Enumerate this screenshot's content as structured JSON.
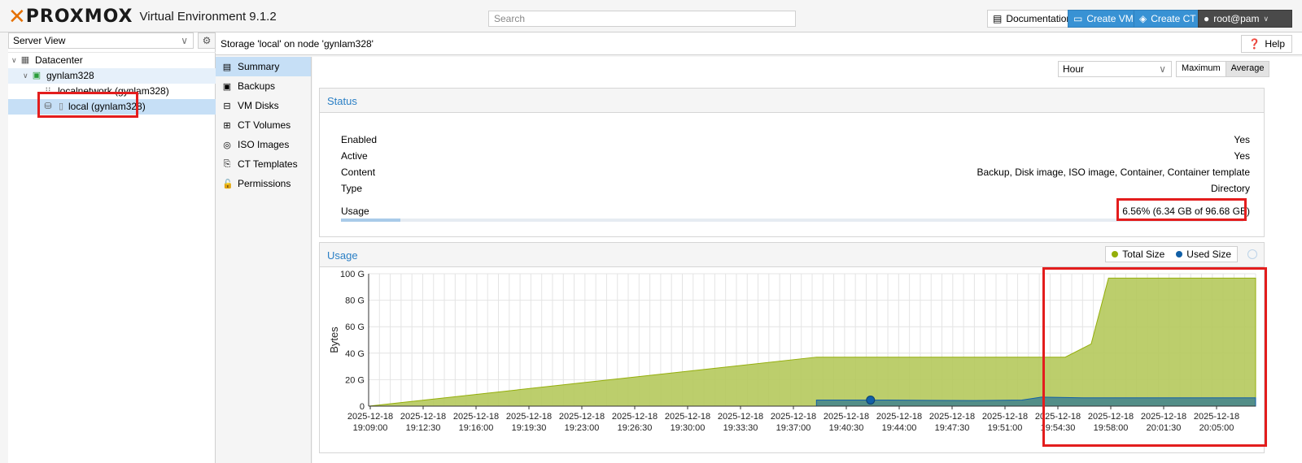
{
  "app": {
    "logo": "PROXMOX",
    "title": "Virtual Environment 9.1.2",
    "search_placeholder": "Search",
    "documentation": "Documentation",
    "create_vm": "Create VM",
    "create_ct": "Create CT",
    "user": "root@pam"
  },
  "tree": {
    "view": "Server View",
    "datacenter": "Datacenter",
    "node": "gynlam328",
    "network": "localnetwork (gynlam328)",
    "storage": "local (gynlam328)"
  },
  "main": {
    "title": "Storage 'local' on node 'gynlam328'",
    "help": "Help",
    "nav": [
      "Summary",
      "Backups",
      "VM Disks",
      "CT Volumes",
      "ISO Images",
      "CT Templates",
      "Permissions"
    ],
    "timeframe": "Hour",
    "cf_max": "Maximum",
    "cf_avg": "Average"
  },
  "status": {
    "heading": "Status",
    "rows": [
      {
        "label": "Enabled",
        "value": "Yes"
      },
      {
        "label": "Active",
        "value": "Yes"
      },
      {
        "label": "Content",
        "value": "Backup, Disk image, ISO image, Container, Container template"
      },
      {
        "label": "Type",
        "value": "Directory"
      },
      {
        "label": "Usage",
        "value": "6.56% (6.34 GB of 96.68 GB)"
      }
    ],
    "usage_fraction": 0.0656
  },
  "usage_chart": {
    "heading": "Usage",
    "legend_total": "Total Size",
    "legend_used": "Used Size",
    "colors": {
      "total": "#94ae0a",
      "used": "#115fa6"
    }
  },
  "chart_data": {
    "type": "area",
    "title": "",
    "xlabel": "",
    "ylabel": "Bytes",
    "ylim": [
      0,
      100
    ],
    "y_ticks": [
      "0",
      "20 G",
      "40 G",
      "60 G",
      "80 G",
      "100 G"
    ],
    "x_tick_labels": [
      [
        "2025-12-18",
        "19:09:00"
      ],
      [
        "2025-12-18",
        "19:12:30"
      ],
      [
        "2025-12-18",
        "19:16:00"
      ],
      [
        "2025-12-18",
        "19:19:30"
      ],
      [
        "2025-12-18",
        "19:23:00"
      ],
      [
        "2025-12-18",
        "19:26:30"
      ],
      [
        "2025-12-18",
        "19:30:00"
      ],
      [
        "2025-12-18",
        "19:33:30"
      ],
      [
        "2025-12-18",
        "19:37:00"
      ],
      [
        "2025-12-18",
        "19:40:30"
      ],
      [
        "2025-12-18",
        "19:44:00"
      ],
      [
        "2025-12-18",
        "19:47:30"
      ],
      [
        "2025-12-18",
        "19:51:00"
      ],
      [
        "2025-12-18",
        "19:54:30"
      ],
      [
        "2025-12-18",
        "19:58:00"
      ],
      [
        "2025-12-18",
        "20:01:30"
      ],
      [
        "2025-12-18",
        "20:05:00"
      ]
    ],
    "x": [
      "19:26:30",
      "19:53:00",
      "19:54:30",
      "19:55:30",
      "20:07:00"
    ],
    "series": [
      {
        "name": "Total Size",
        "unit": "G",
        "points": [
          [
            0,
            0
          ],
          [
            10.35,
            37
          ],
          [
            15.5,
            37
          ],
          [
            16.1,
            37
          ],
          [
            16.7,
            47
          ],
          [
            17.1,
            96.7
          ],
          [
            20.5,
            96.7
          ]
        ]
      },
      {
        "name": "Used Size",
        "unit": "G",
        "points": [
          [
            10.35,
            4.6
          ],
          [
            12.0,
            4.6
          ],
          [
            14.0,
            4.2
          ],
          [
            15.1,
            4.6
          ],
          [
            15.55,
            6.8
          ],
          [
            16.5,
            6.3
          ],
          [
            20.5,
            6.3
          ]
        ]
      }
    ],
    "marker": {
      "series": "Used Size",
      "x_index": 11.6,
      "value": 4.6
    },
    "grid": true
  }
}
